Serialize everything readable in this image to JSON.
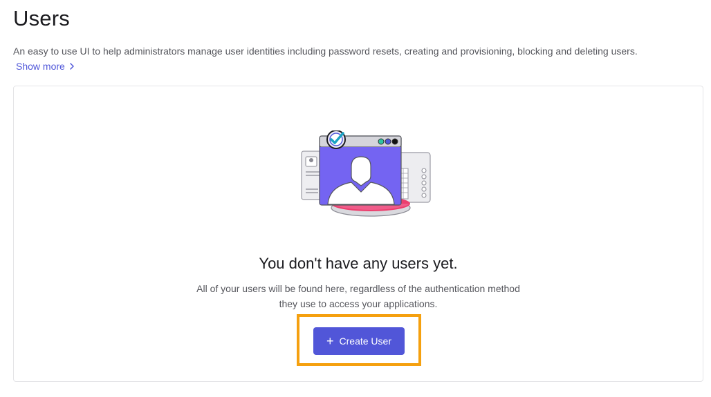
{
  "header": {
    "title": "Users",
    "description": "An easy to use UI to help administrators manage user identities including password resets, creating and provisioning, blocking and deleting users.",
    "show_more": "Show more"
  },
  "empty_state": {
    "illustration_icon": "user-profile-illustration",
    "title": "You don't have any users yet.",
    "description": "All of your users will be found here, regardless of the authentication method they use to access your applications.",
    "create_button_label": "Create User",
    "create_button_icon": "plus-icon"
  },
  "colors": {
    "accent": "#5156d8",
    "link": "#4f56d9",
    "highlight": "#f5a00f"
  }
}
